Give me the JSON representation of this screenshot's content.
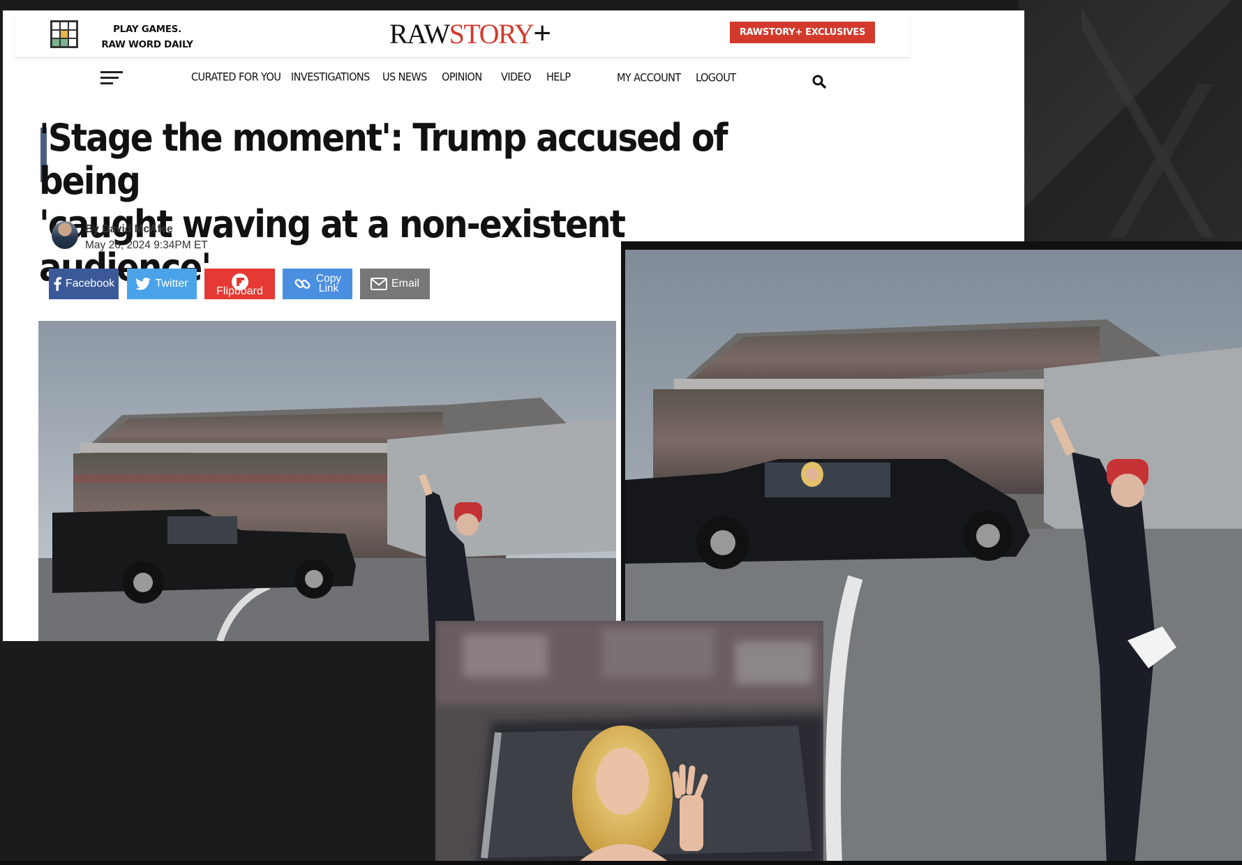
{
  "header": {
    "play_games_line1": "PLAY GAMES.",
    "play_games_line2": "RAW WORD DAILY",
    "logo_raw": "RAW",
    "logo_story": "STORY",
    "logo_plus": "+",
    "exclusives_label": "RAWSTORY+ EXCLUSIVES"
  },
  "nav": {
    "items": [
      "CURATED FOR YOU",
      "INVESTIGATIONS",
      "US NEWS",
      "OPINION",
      "VIDEO",
      "HELP"
    ],
    "my_account": "MY ACCOUNT",
    "logout": "LOGOUT"
  },
  "article": {
    "headline_line1": "'Stage the moment': Trump accused of being",
    "headline_line2": "'caught waving at a non-existent audience'",
    "byline": "By David McAfee",
    "date": "May 26, 2024 9:34PM ET"
  },
  "share": {
    "facebook": "Facebook",
    "twitter": "Twitter",
    "flipboard": "Flipboard",
    "copy_line1": "Copy",
    "copy_line2": "Link",
    "email": "Email"
  },
  "colors": {
    "brand_red": "#d33a2c",
    "facebook": "#3b5998",
    "twitter": "#4aa3e8",
    "flipboard": "#e53a33",
    "copy_link": "#4a8fe0",
    "email": "#777777"
  }
}
